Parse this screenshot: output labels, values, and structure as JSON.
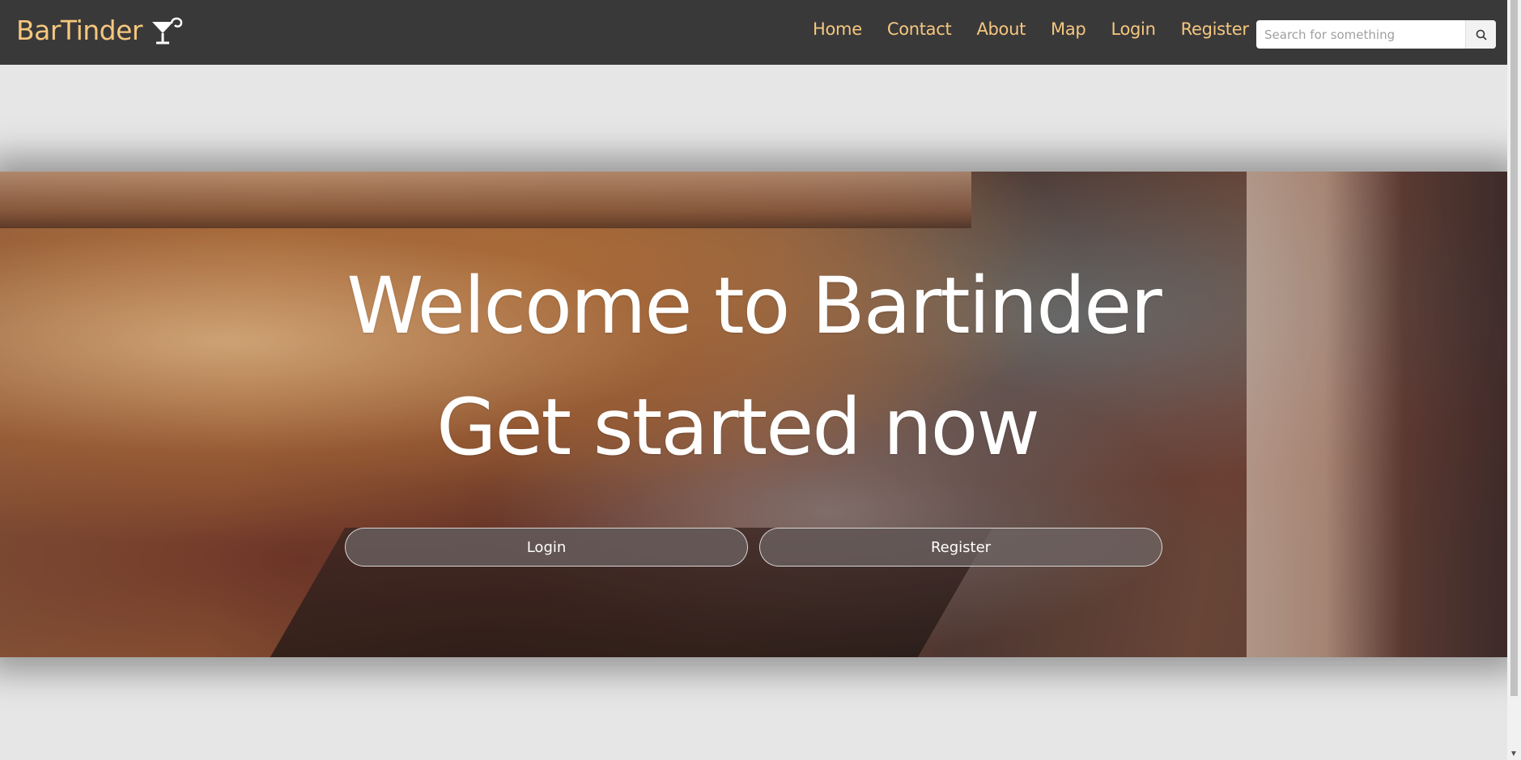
{
  "brand": {
    "name": "BarTinder",
    "icon": "cocktail-glass-icon",
    "color": "#f5c77e"
  },
  "nav": {
    "items": [
      {
        "label": "Home"
      },
      {
        "label": "Contact"
      },
      {
        "label": "About"
      },
      {
        "label": "Map"
      },
      {
        "label": "Login"
      },
      {
        "label": "Register"
      }
    ]
  },
  "search": {
    "placeholder": "Search for something",
    "value": "",
    "icon": "search-icon"
  },
  "hero": {
    "title": "Welcome to Bartinder",
    "subtitle": "Get started now",
    "login_label": "Login",
    "register_label": "Register"
  },
  "colors": {
    "navbar_bg": "#3a393a",
    "accent": "#f5c77e",
    "page_bg": "#e6e6e6"
  }
}
